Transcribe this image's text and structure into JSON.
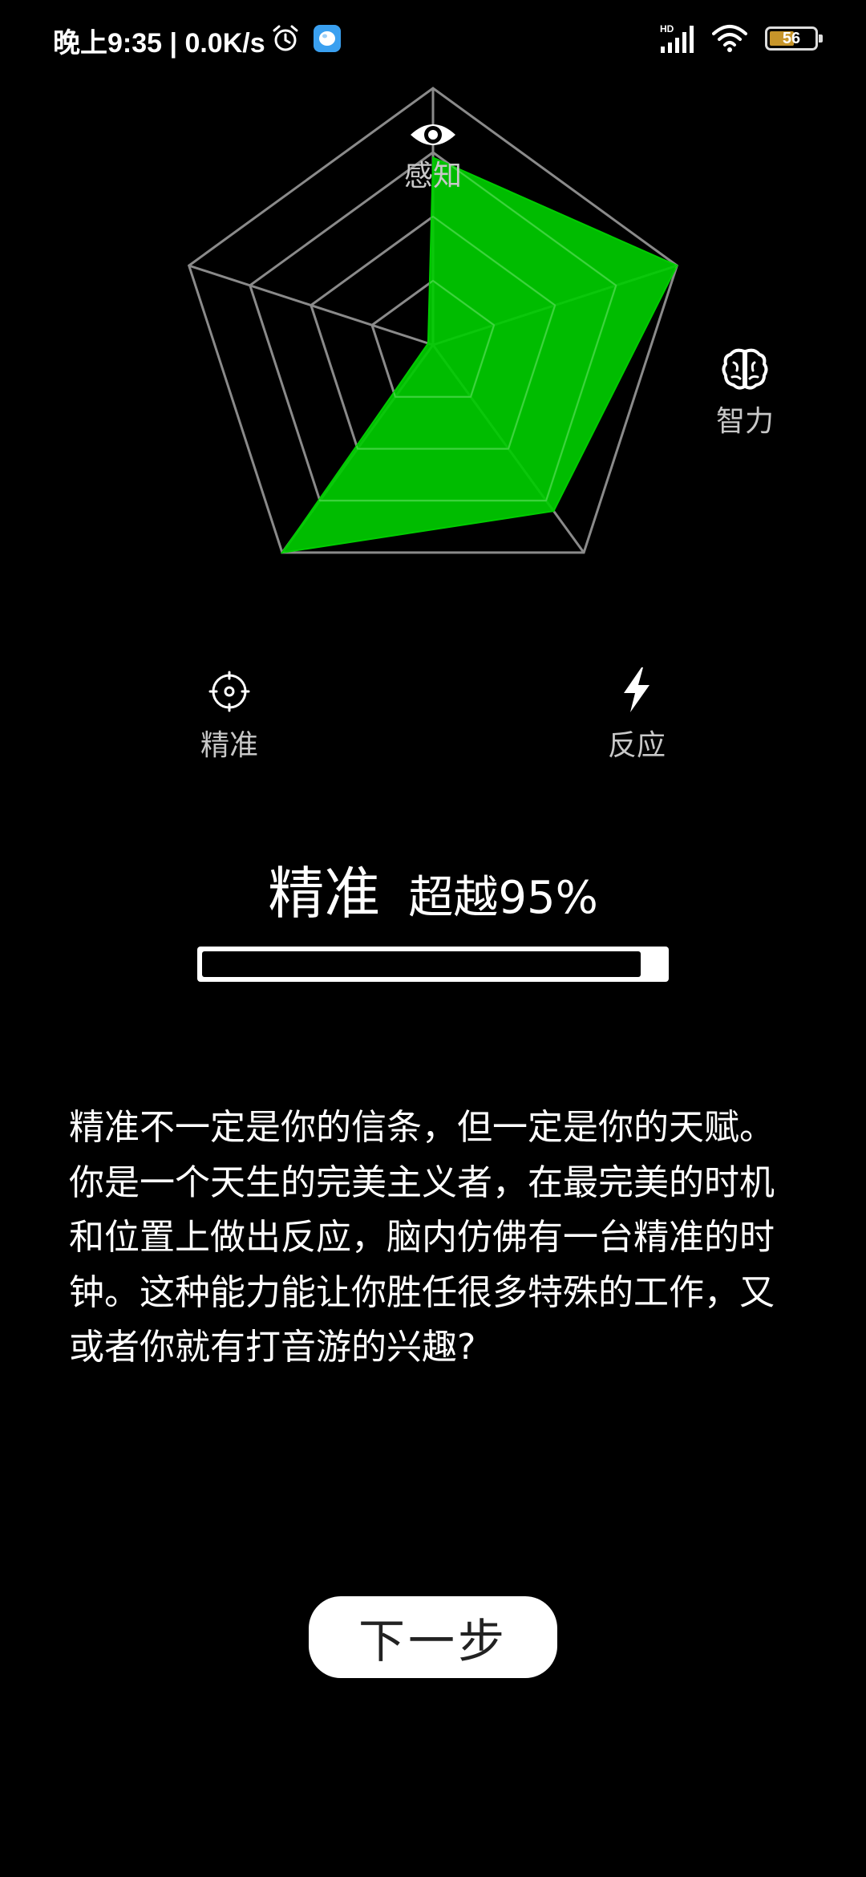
{
  "status_bar": {
    "time_speed": "晚上9:35 | 0.0K/s",
    "network_label": "HD",
    "battery_level": "56",
    "battery_fraction": 0.56,
    "icons": [
      "alarm-clock-icon",
      "app-notification-icon",
      "signal-strength-icon",
      "wifi-icon",
      "battery-icon"
    ]
  },
  "chart_data": {
    "type": "radar",
    "axes": [
      {
        "name": "感知",
        "icon": "eye-icon",
        "value": 0.73
      },
      {
        "name": "智力",
        "icon": "brain-icon",
        "value": 1.0
      },
      {
        "name": "反应",
        "icon": "lightning-icon",
        "value": 0.8
      },
      {
        "name": "精准",
        "icon": "crosshair-target-icon",
        "value": 1.0
      },
      {
        "name": "",
        "icon": "",
        "value": 0.02
      }
    ],
    "rings": 4,
    "range": [
      0,
      1
    ],
    "fill_color": "#00cc00",
    "grid_color": "#8a8a8a"
  },
  "result": {
    "name": "精准",
    "percent_text": "超越95%",
    "progress": 0.95
  },
  "description": "精准不一定是你的信条，但一定是你的天赋。你是一个天生的完美主义者，在最完美的时机和位置上做出反应，脑内仿佛有一台精准的时钟。这种能力能让你胜任很多特殊的工作，又或者你就有打音游的兴趣?",
  "next_button": {
    "label": "下一步"
  }
}
